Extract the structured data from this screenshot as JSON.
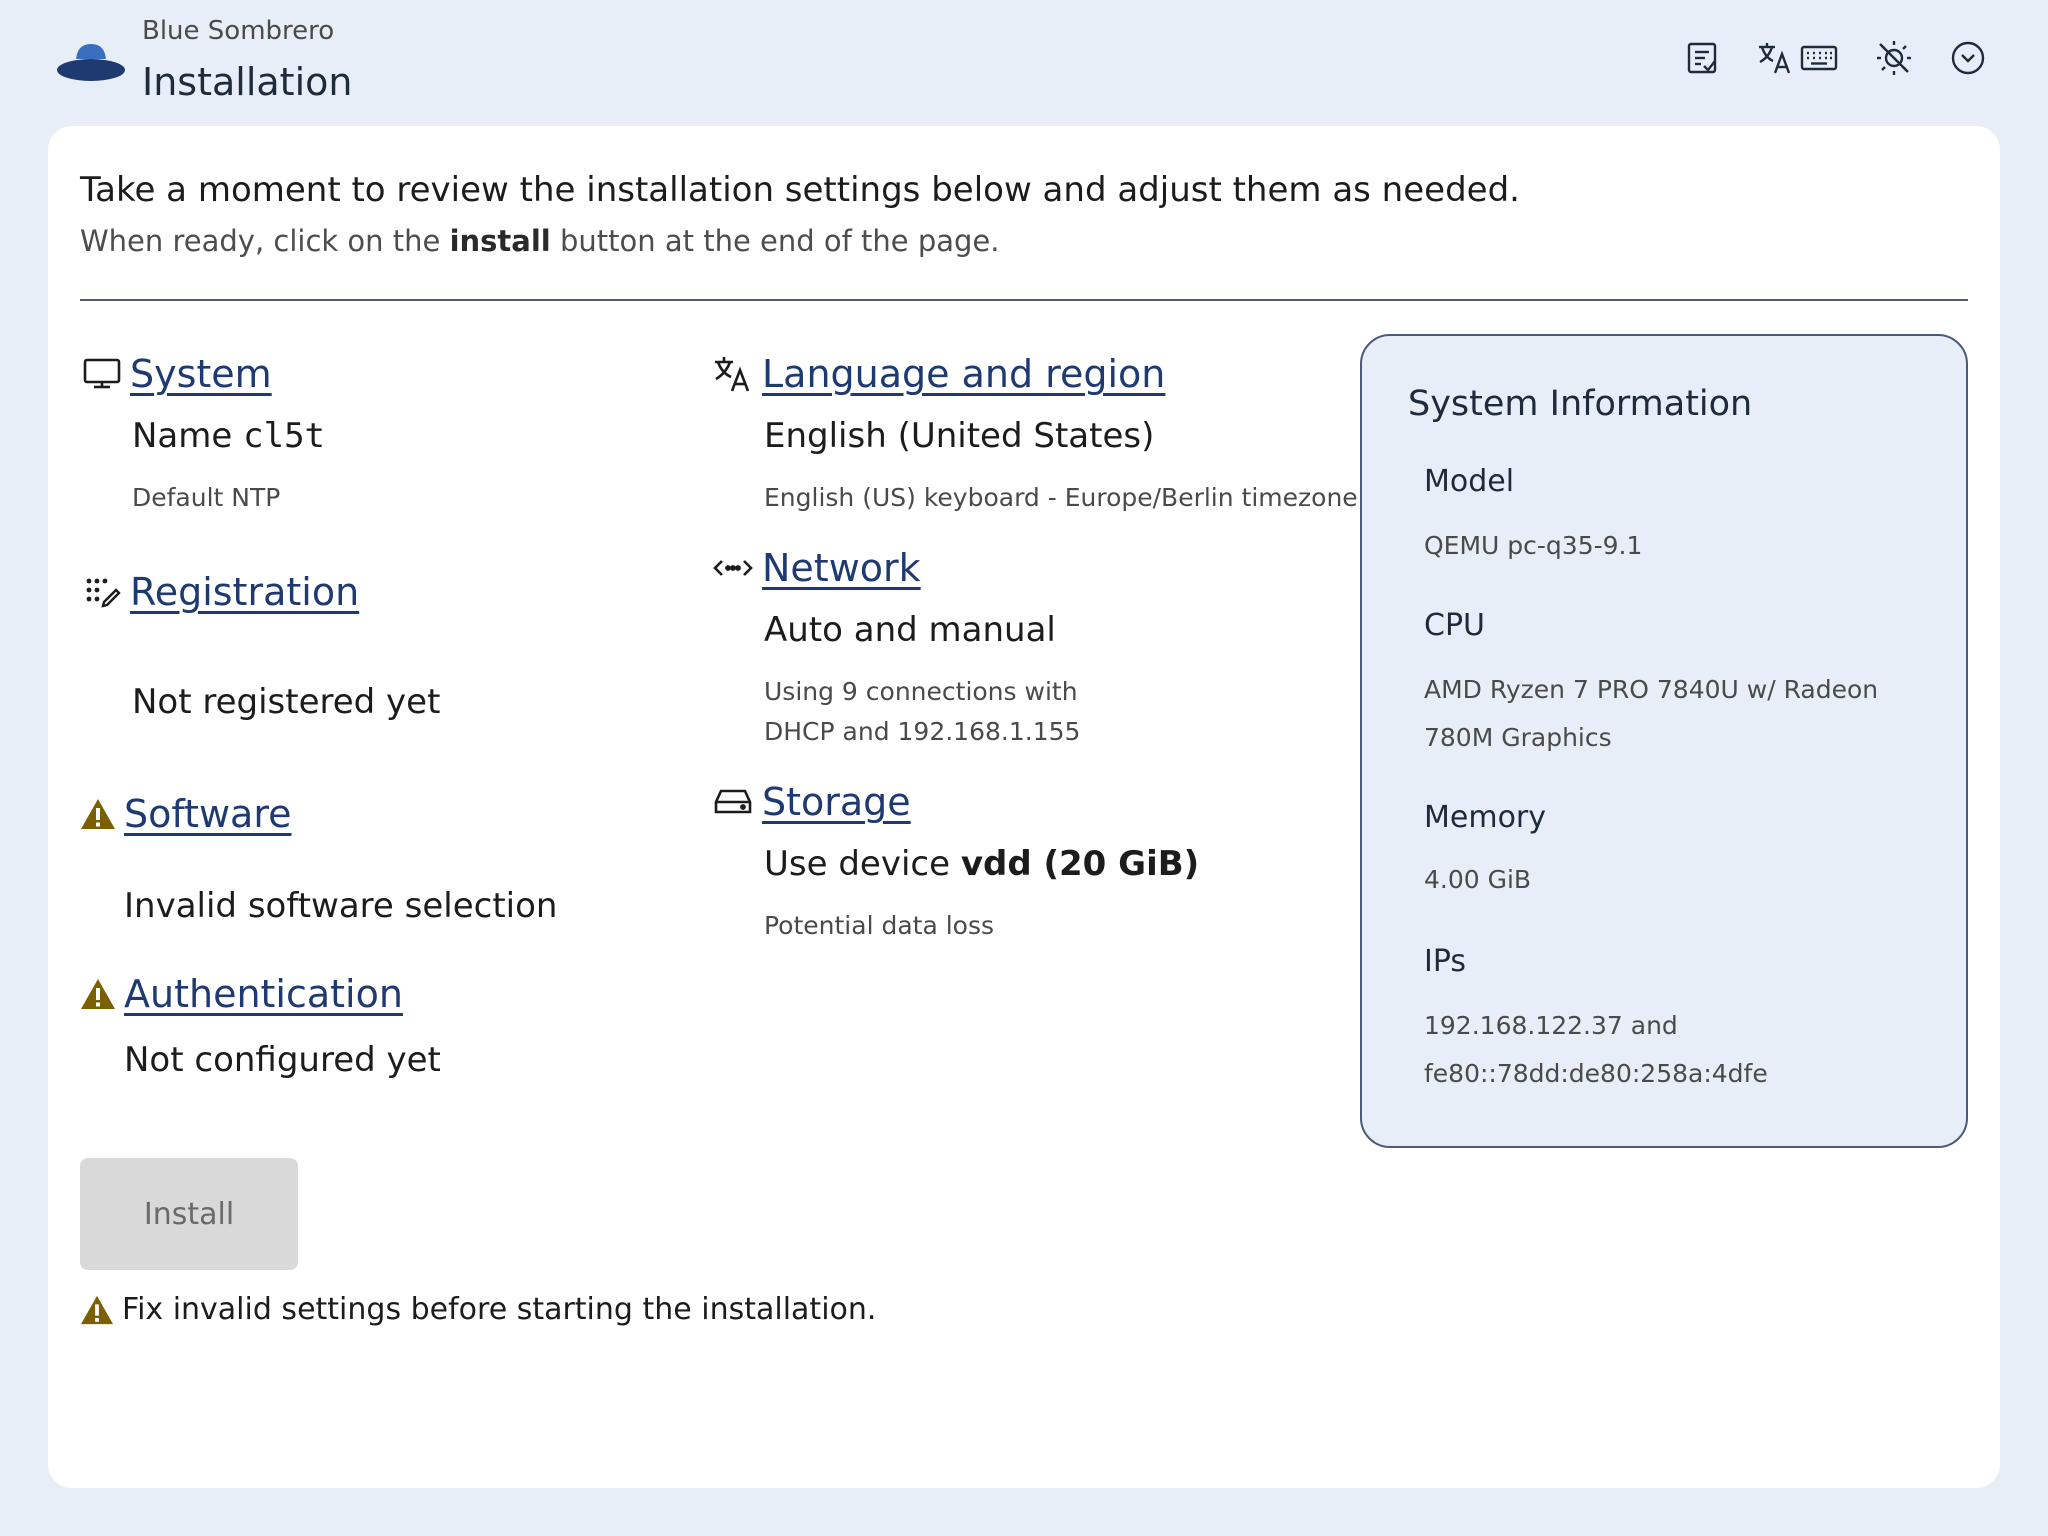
{
  "header": {
    "brand": "Blue Sombrero",
    "title": "Installation",
    "icons": [
      "review-checklist-icon",
      "language-icon",
      "keyboard-icon",
      "dark-mode-icon",
      "menu-chevron-icon"
    ]
  },
  "intro": {
    "line1": "Take a moment to review the installation settings below and adjust them as needed.",
    "line2_before": "When ready, click on the ",
    "line2_bold": "install",
    "line2_after": " button at the end of the page."
  },
  "sections": {
    "system": {
      "label": "System",
      "name_prefix": "Name ",
      "name_value": "cl5t",
      "detail": "Default NTP",
      "icon": "monitor-icon"
    },
    "registration": {
      "label": "Registration",
      "status": "Not registered yet",
      "icon": "registration-icon"
    },
    "software": {
      "label": "Software",
      "status": "Invalid software selection",
      "icon": "warning-icon"
    },
    "authentication": {
      "label": "Authentication",
      "status": "Not configured yet",
      "icon": "warning-icon"
    },
    "language": {
      "label": "Language and region",
      "value": "English (United States)",
      "detail": "English (US) keyboard - Europe/Berlin timezone",
      "icon": "language-icon"
    },
    "network": {
      "label": "Network",
      "value": "Auto and manual",
      "detail_line1": "Using 9 connections with",
      "detail_line2": "DHCP and 192.168.1.155",
      "icon": "network-icon"
    },
    "storage": {
      "label": "Storage",
      "value_prefix": "Use device ",
      "value_bold": "vdd (20 GiB)",
      "detail": "Potential data loss",
      "icon": "disk-icon"
    }
  },
  "install": {
    "button_label": "Install",
    "disabled": true,
    "warning": "Fix invalid settings before starting the installation."
  },
  "system_info": {
    "title": "System Information",
    "model_label": "Model",
    "model_value": "QEMU pc-q35-9.1",
    "cpu_label": "CPU",
    "cpu_value": "AMD Ryzen 7 PRO 7840U w/ Radeon 780M Graphics",
    "memory_label": "Memory",
    "memory_value": "4.00 GiB",
    "ips_label": "IPs",
    "ips_value_line1": "192.168.122.37 and",
    "ips_value_line2": "fe80::78dd:de80:258a:4dfe"
  },
  "colors": {
    "background": "#e8eef8",
    "card": "#ffffff",
    "link": "#1f3a70",
    "warning": "#7a6000",
    "logo_dark": "#1f3a70",
    "logo_light": "#3a6fbf"
  }
}
